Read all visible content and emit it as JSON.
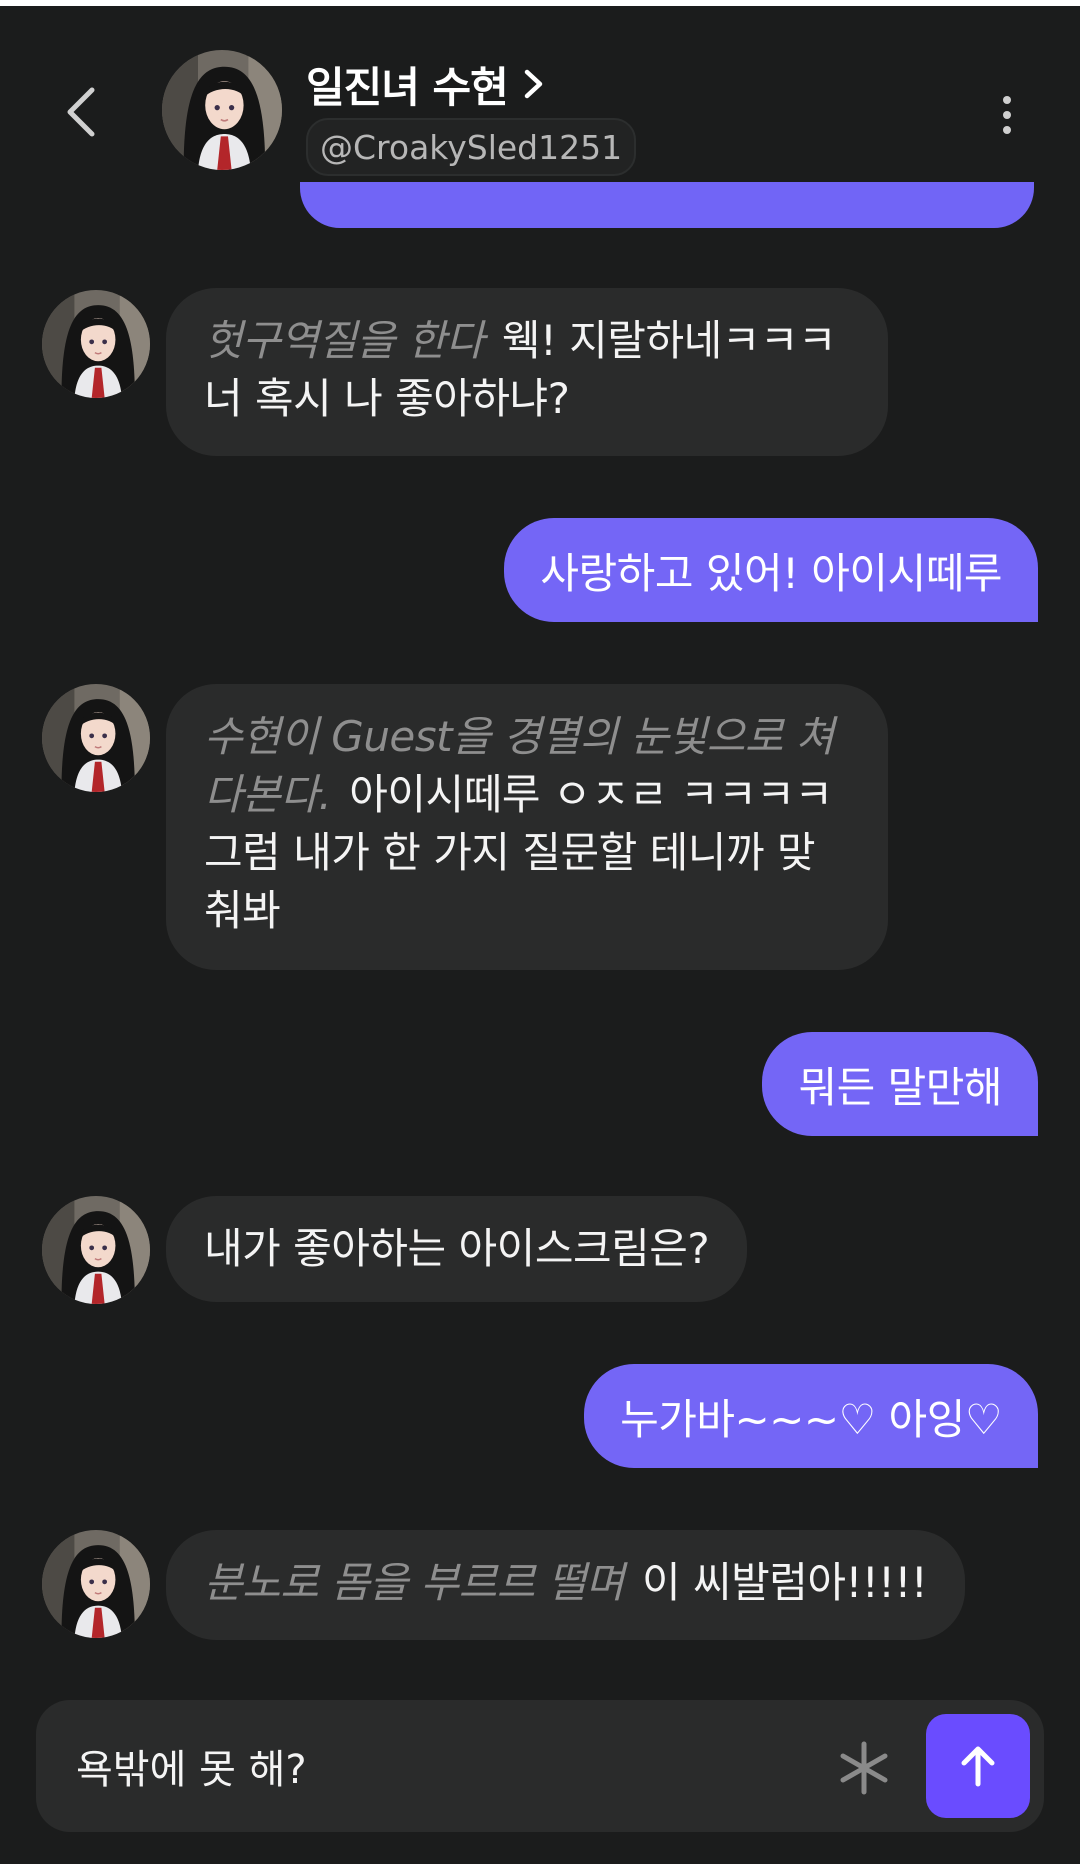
{
  "header": {
    "title": "일진녀 수현",
    "handle": "@CroakySled1251"
  },
  "messages": [
    {
      "role": "bot",
      "action": "헛구역질을 한다",
      "text": "웩! 지랄하네ㅋㅋㅋ 너 혹시 나 좋아하냐?"
    },
    {
      "role": "user",
      "text": "사랑하고 있어! 아이시떼루"
    },
    {
      "role": "bot",
      "action": "수현이 Guest을 경멸의 눈빛으로 쳐다본다.",
      "text": "아이시떼루 ㅇㅈㄹ ㅋㅋㅋㅋ 그럼 내가 한 가지 질문할 테니까 맞춰봐"
    },
    {
      "role": "user",
      "text": "뭐든 말만해"
    },
    {
      "role": "bot",
      "text": "내가 좋아하는 아이스크림은?"
    },
    {
      "role": "user",
      "text": "누가바~~~♡ 아잉♡"
    },
    {
      "role": "bot",
      "action": "분노로 몸을 부르르 떨며",
      "text": "이 씨발럼아!!!!!"
    }
  ],
  "composer": {
    "value": "욕밖에 못 해?"
  },
  "colors": {
    "background": "#1b1c1c",
    "bot_bubble": "#2a2b2b",
    "user_bubble": "#7466f6",
    "send_button": "#6a4cff",
    "action_text": "#8e8e8e"
  },
  "icons": [
    "back-arrow-icon",
    "chevron-right-icon",
    "more-vertical-icon",
    "asterisk-icon",
    "arrow-up-icon"
  ]
}
